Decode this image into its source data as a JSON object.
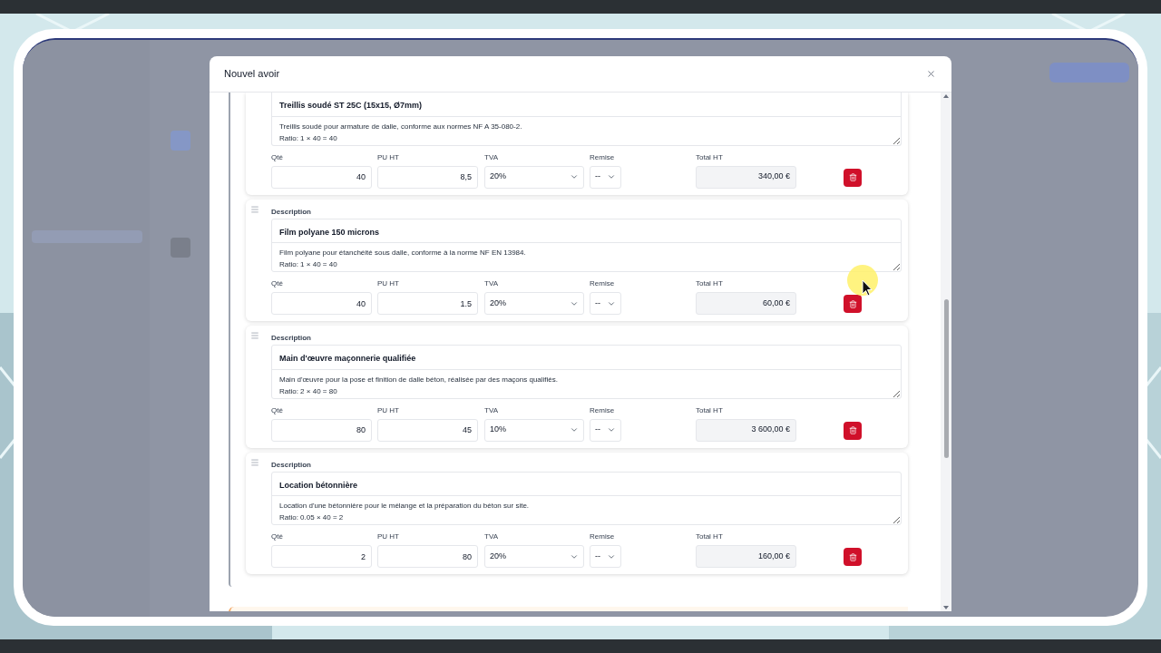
{
  "window": {
    "title": "Nouvel avoir"
  },
  "lines": [
    {
      "title": "Treillis soudé ST 25C (15x15, Ø7mm)",
      "description": "Treillis soudé pour armature de dalle, conforme aux normes NF A 35-080-2.\nRatio: 1 × 40 = 40",
      "fields": [
        {
          "label": "Qté",
          "value": "40",
          "kind": "input"
        },
        {
          "label": "PU HT",
          "value": "8,5",
          "kind": "input"
        },
        {
          "label": "TVA",
          "value": "20%",
          "kind": "select"
        },
        {
          "label": "Remise",
          "value": "--",
          "kind": "select"
        },
        {
          "label": "Total HT",
          "value": "340,00 €",
          "kind": "readonly"
        }
      ]
    },
    {
      "description_label": "Description",
      "title": "Film polyane 150 microns",
      "description": "Film polyane pour étanchéité sous dalle, conforme à la norme NF EN 13984.\nRatio: 1 × 40 = 40",
      "fields": [
        {
          "label": "Qté",
          "value": "40",
          "kind": "input"
        },
        {
          "label": "PU HT",
          "value": "1.5",
          "kind": "input"
        },
        {
          "label": "TVA",
          "value": "20%",
          "kind": "select"
        },
        {
          "label": "Remise",
          "value": "--",
          "kind": "select"
        },
        {
          "label": "Total HT",
          "value": "60,00 €",
          "kind": "readonly"
        }
      ]
    },
    {
      "description_label": "Description",
      "title": "Main d'œuvre maçonnerie qualifiée",
      "description": "Main d'œuvre pour la pose et finition de dalle béton, réalisée par des maçons qualifiés.\nRatio: 2 × 40 = 80",
      "fields": [
        {
          "label": "Qté",
          "value": "80",
          "kind": "input"
        },
        {
          "label": "PU HT",
          "value": "45",
          "kind": "input"
        },
        {
          "label": "TVA",
          "value": "10%",
          "kind": "select"
        },
        {
          "label": "Remise",
          "value": "--",
          "kind": "select"
        },
        {
          "label": "Total HT",
          "value": "3 600,00 €",
          "kind": "readonly"
        }
      ]
    },
    {
      "description_label": "Description",
      "title": "Location bétonnière",
      "description": "Location d'une bétonnière pour le mélange et la préparation du béton sur site.\nRatio: 0.05 × 40 = 2",
      "fields": [
        {
          "label": "Qté",
          "value": "2",
          "kind": "input"
        },
        {
          "label": "PU HT",
          "value": "80",
          "kind": "input"
        },
        {
          "label": "TVA",
          "value": "20%",
          "kind": "select"
        },
        {
          "label": "Remise",
          "value": "--",
          "kind": "select"
        },
        {
          "label": "Total HT",
          "value": "160,00 €",
          "kind": "readonly"
        }
      ]
    }
  ]
}
